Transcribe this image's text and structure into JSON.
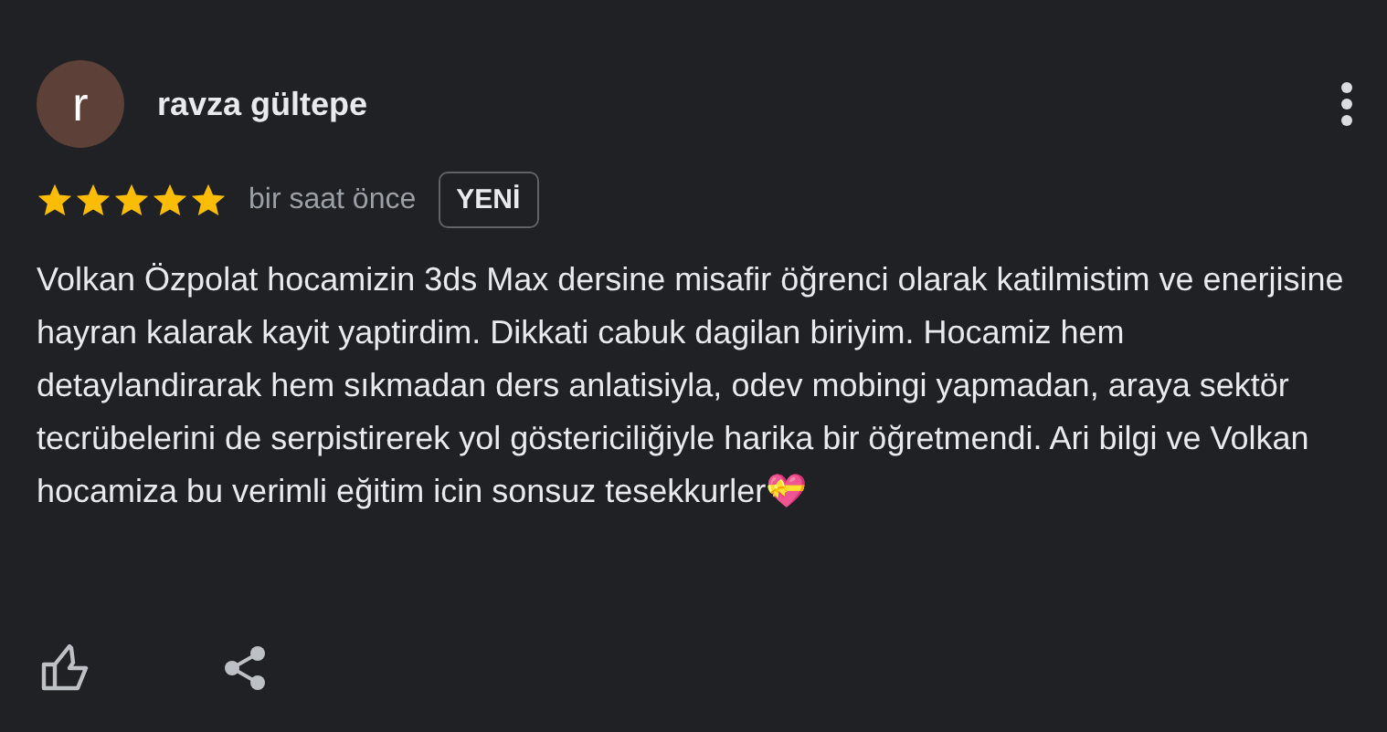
{
  "review": {
    "avatar_letter": "r",
    "author": "ravza gültepe",
    "stars": 5,
    "time": "bir saat önce",
    "badge": "YENİ",
    "text": "Volkan Özpolat hocamizin 3ds Max dersine misafir öğrenci olarak katilmistim ve enerjisine hayran kalarak kayit yaptirdim. Dikkati cabuk dagilan biriyim. Hocamiz hem detaylandirarak hem sıkmadan ders anlatisiyla, odev mobingi yapmadan, araya sektör tecrübelerini de serpistirerek yol göstericiliğiyle harika bir öğretmendi. Ari bilgi ve Volkan hocamiza bu verimli eğitim icin sonsuz tesekkurler💝"
  }
}
